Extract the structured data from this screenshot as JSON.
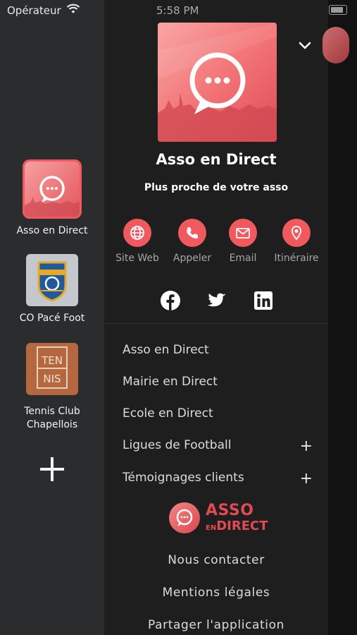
{
  "status_bar": {
    "carrier": "Opérateur",
    "time": "5:58 PM"
  },
  "rail": {
    "apps": [
      {
        "label": "Asso en Direct",
        "selected": true
      },
      {
        "label": "CO Pacé Foot",
        "selected": false
      },
      {
        "label": "Tennis Club Chapellois",
        "selected": false
      }
    ],
    "tennis_logo_text": [
      "TEN",
      "NIS"
    ]
  },
  "drawer": {
    "title": "Asso en Direct",
    "subtitle": "Plus proche de votre asso",
    "actions": [
      {
        "label": "Site Web",
        "icon": "globe-icon"
      },
      {
        "label": "Appeler",
        "icon": "phone-icon"
      },
      {
        "label": "Email",
        "icon": "envelope-icon"
      },
      {
        "label": "Itinéraire",
        "icon": "map-pin-icon"
      }
    ],
    "social": [
      "facebook-icon",
      "twitter-icon",
      "linkedin-icon"
    ],
    "menu": [
      {
        "label": "Asso en Direct",
        "expandable": false
      },
      {
        "label": "Mairie en Direct",
        "expandable": false
      },
      {
        "label": "Ecole en Direct",
        "expandable": false
      },
      {
        "label": "Ligues de Football",
        "expandable": true
      },
      {
        "label": "Témoignages clients",
        "expandable": true
      }
    ],
    "menu_plus": "+",
    "brand": {
      "line1": "ASSO",
      "line2_small": "EN",
      "line2": "DIRECT"
    },
    "footer_links": [
      "Nous contacter",
      "Mentions légales",
      "Partager l'application"
    ]
  },
  "colors": {
    "accent": "#f05a5e",
    "rail_bg": "#2a2c2e",
    "drawer_bg": "#1e1e1f"
  }
}
